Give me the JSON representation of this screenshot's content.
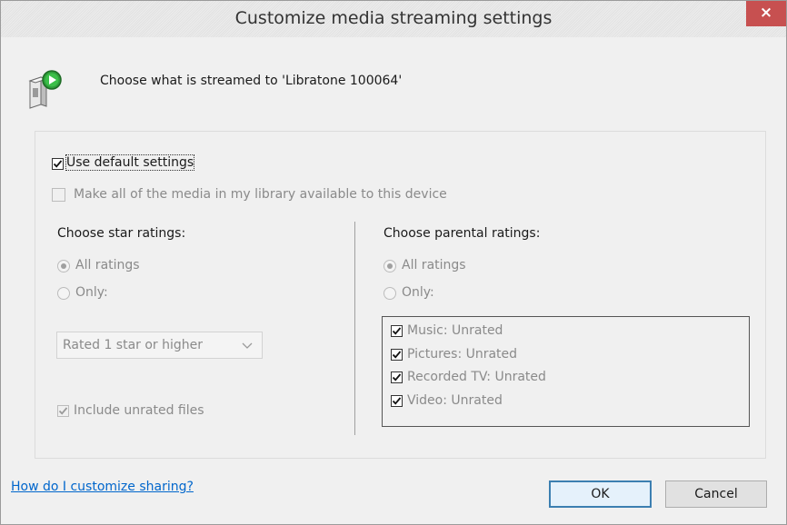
{
  "window": {
    "title": "Customize media streaming settings",
    "close_label": "×"
  },
  "header": {
    "text": "Choose what is streamed to 'Libratone 100064'",
    "icon": "media-device-stream-icon"
  },
  "options": {
    "use_default_label": "Use default settings",
    "use_default_checked": true,
    "make_all_label": "Make all of the media in my library available to this device",
    "make_all_checked": false
  },
  "star_ratings": {
    "title": "Choose star ratings:",
    "all_label": "All ratings",
    "only_label": "Only:",
    "selected": "All ratings",
    "dropdown_value": "Rated 1 star or higher",
    "include_unrated_label": "Include unrated files",
    "include_unrated_checked": true
  },
  "parental_ratings": {
    "title": "Choose parental ratings:",
    "all_label": "All ratings",
    "only_label": "Only:",
    "selected": "All ratings",
    "items": [
      {
        "label": "Music: Unrated",
        "checked": true
      },
      {
        "label": "Pictures: Unrated",
        "checked": true
      },
      {
        "label": "Recorded TV: Unrated",
        "checked": true
      },
      {
        "label": "Video: Unrated",
        "checked": true
      }
    ]
  },
  "footer": {
    "help_link": "How do I customize sharing?",
    "ok_label": "OK",
    "cancel_label": "Cancel"
  },
  "colors": {
    "close_button": "#c75050",
    "link": "#0066cc",
    "default_button_border": "#3c7fb1"
  }
}
